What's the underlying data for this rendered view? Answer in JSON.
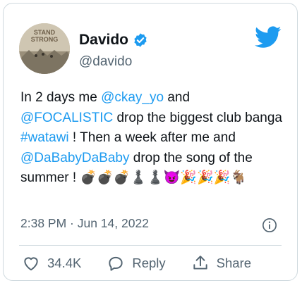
{
  "author": {
    "name": "Davido",
    "handle": "@davido",
    "avatar_text_line1": "STAND",
    "avatar_text_line2": "STRONG",
    "verified": true
  },
  "tweet": {
    "t1": "In 2 days me ",
    "m1": "@ckay_yo",
    "t2": " and ",
    "m2": "@FOCALISTIC",
    "t3": " drop the biggest club banga ",
    "h1": "#watawi",
    "t4": " ! Then a week after me and ",
    "m3": "@DaBabyDaBaby",
    "t5": " drop the song of the summer ! ",
    "emojis": "💣💣💣♟️♟️😈🎉🎉🎉🐐"
  },
  "meta": {
    "timestamp": "2:38 PM · Jun 14, 2022"
  },
  "actions": {
    "like_count": "34.4K",
    "reply_label": "Reply",
    "share_label": "Share"
  },
  "colors": {
    "link": "#1d9bf0",
    "secondary_text": "#536471",
    "twitter_blue": "#1d9bf0"
  }
}
